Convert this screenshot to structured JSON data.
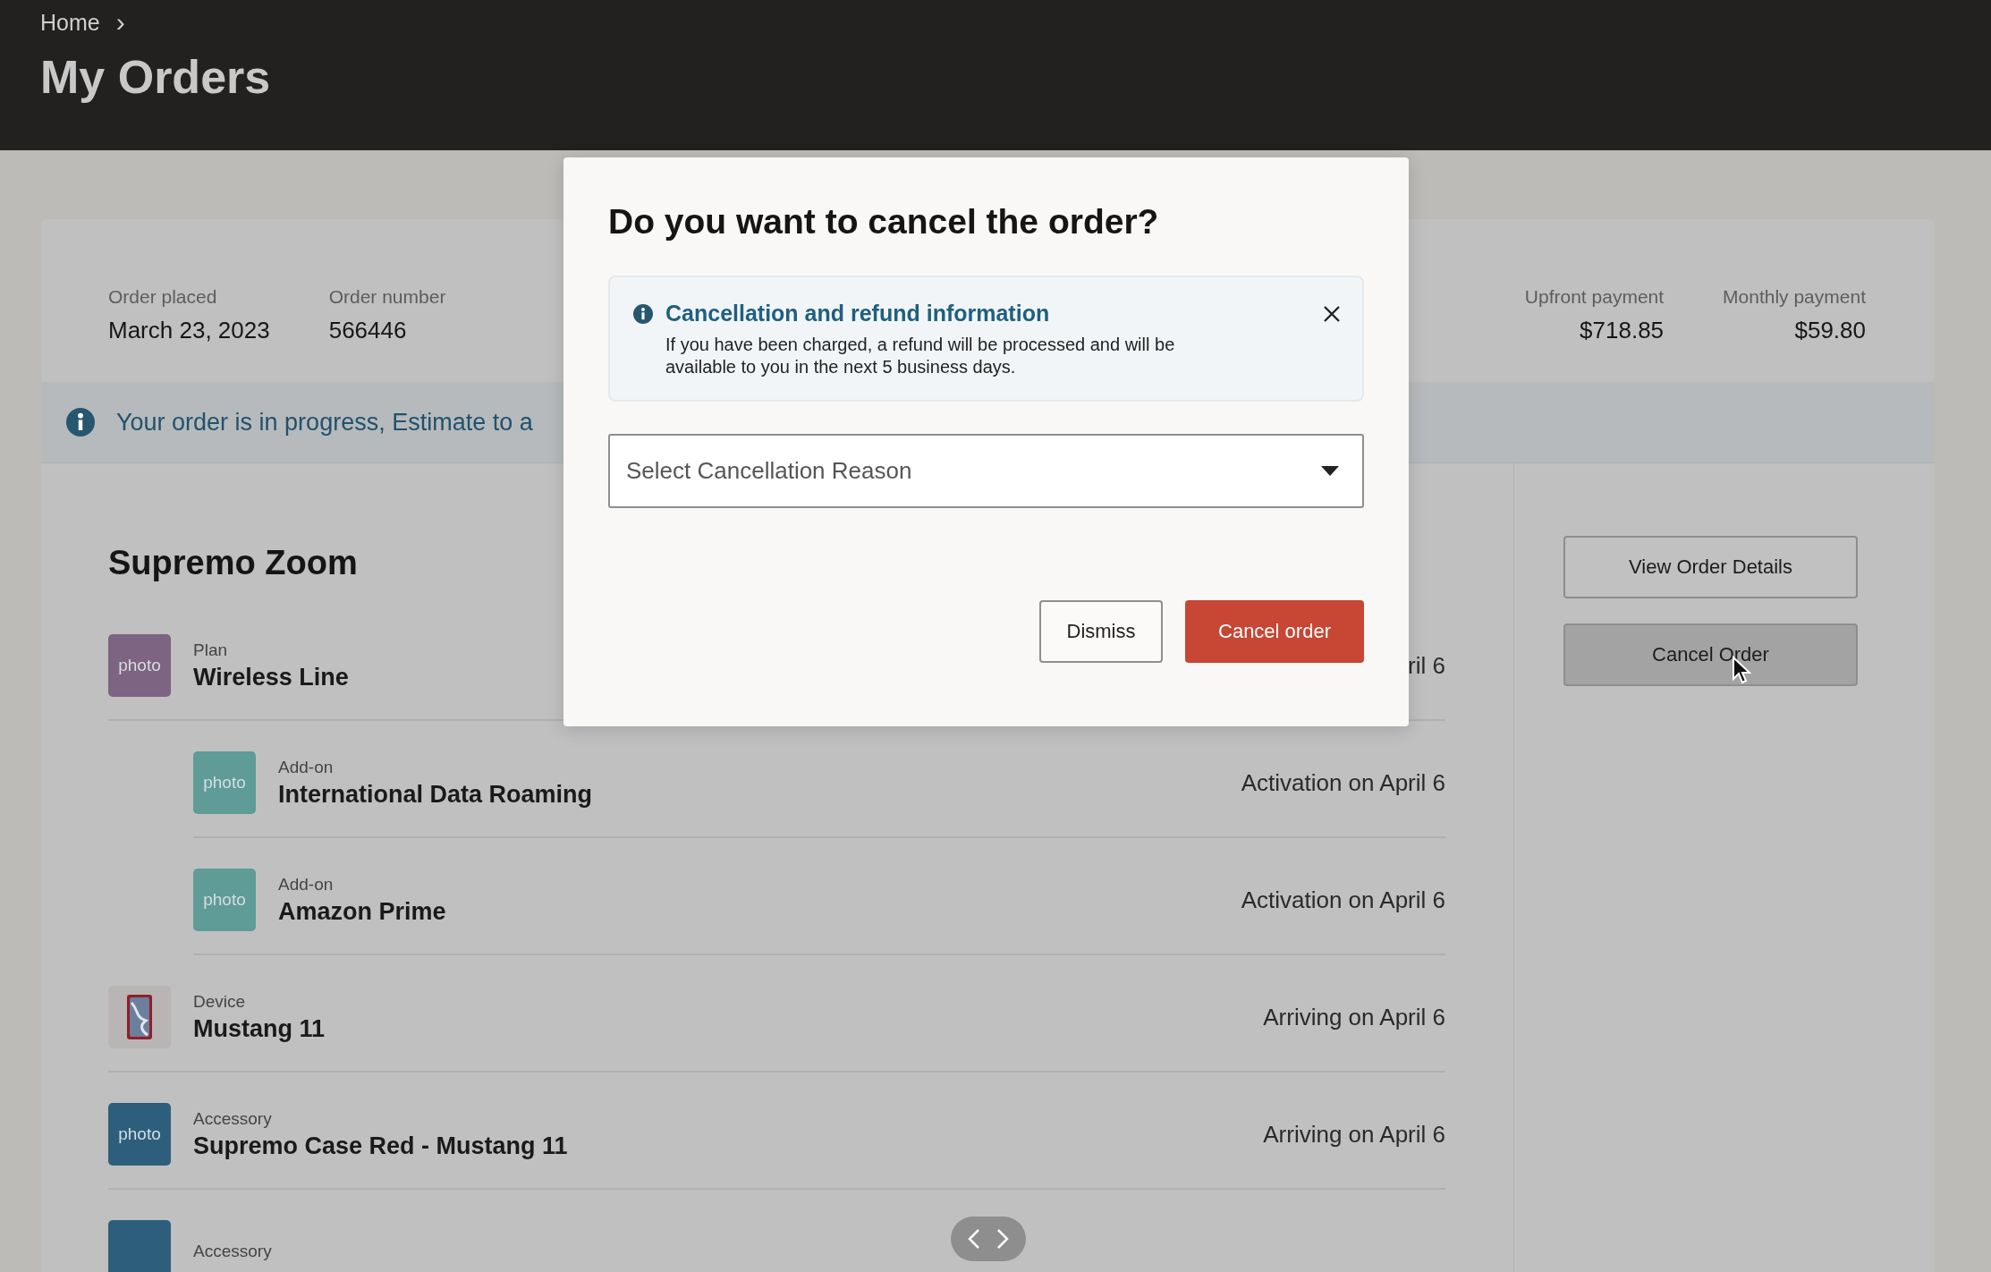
{
  "breadcrumb": [
    {
      "label": "Home",
      "separator": "›"
    }
  ],
  "page_title": "My Orders",
  "order_summary": {
    "left": [
      {
        "label": "Order placed",
        "value": "March 23, 2023"
      },
      {
        "label": "Order number",
        "value": "566446"
      }
    ],
    "right": [
      {
        "label": "Upfront payment",
        "value": "$718.85"
      },
      {
        "label": "Monthly payment",
        "value": "$59.80"
      }
    ]
  },
  "status_banner": {
    "text": "Your order is in progress, Estimate to a"
  },
  "product": {
    "title": "Supremo Zoom",
    "items": [
      {
        "kind": "photo",
        "color": "#7d6483",
        "thumb_text": "photo",
        "type": "Plan",
        "name": "Wireless Line",
        "status": "ril 6",
        "children": [
          {
            "kind": "photo",
            "color": "#5f9c97",
            "thumb_text": "photo",
            "type": "Add-on",
            "name": "International Data Roaming",
            "status": "Activation on April 6"
          },
          {
            "kind": "photo",
            "color": "#5f9c97",
            "thumb_text": "photo",
            "type": "Add-on",
            "name": "Amazon Prime",
            "status": "Activation on April 6"
          }
        ]
      },
      {
        "kind": "device",
        "type": "Device",
        "name": "Mustang 11",
        "status": "Arriving on April 6"
      },
      {
        "kind": "photo",
        "color": "#2d5f7d",
        "thumb_text": "photo",
        "type": "Accessory",
        "name": "Supremo Case Red - Mustang 11",
        "status": "Arriving on April 6"
      },
      {
        "kind": "photo",
        "color": "#2d5f7d",
        "type": "Accessory"
      }
    ]
  },
  "actions": [
    {
      "label": "View Order Details",
      "hovered": false
    },
    {
      "label": "Cancel Order",
      "hovered": true
    }
  ],
  "dialog": {
    "title": "Do you want to cancel the order?",
    "info": {
      "title": "Cancellation and refund information",
      "text": "If you have been charged, a refund will be processed and will be available to you in the next 5 business days."
    },
    "select": {
      "placeholder": "Select Cancellation Reason"
    },
    "buttons": [
      {
        "label": "Dismiss",
        "kind": "secondary"
      },
      {
        "label": "Cancel order",
        "kind": "primary"
      }
    ]
  }
}
